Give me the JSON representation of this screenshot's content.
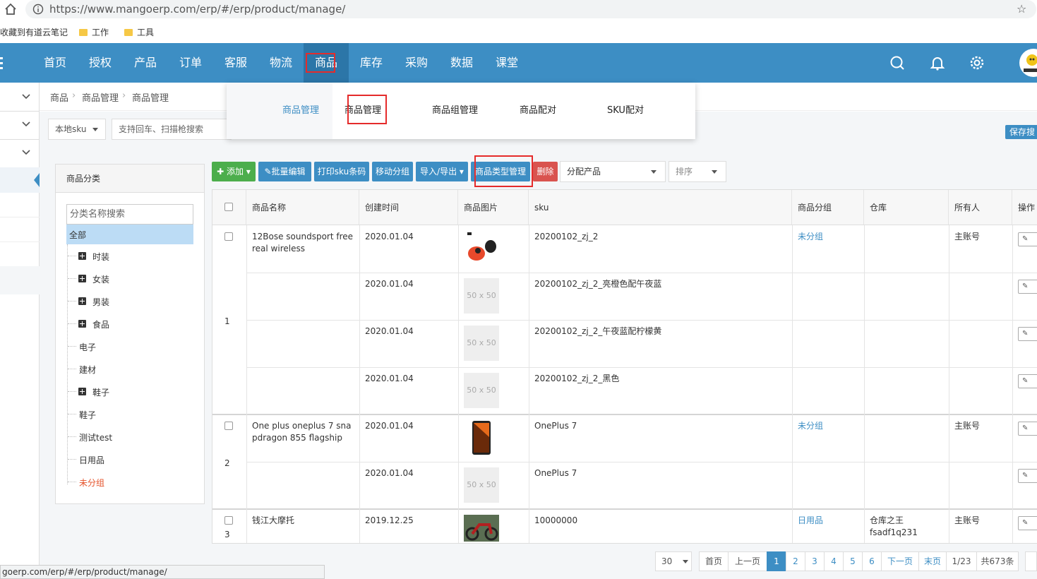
{
  "browser": {
    "url": "https://www.mangoerp.com/erp/#/erp/product/manage/",
    "bookmarks": [
      "收藏到有道云笔记",
      "工作",
      "工具"
    ]
  },
  "nav": {
    "items": [
      "首页",
      "授权",
      "产品",
      "订单",
      "客服",
      "物流",
      "商品",
      "库存",
      "采购",
      "数据",
      "课堂"
    ],
    "active": "商品"
  },
  "breadcrumb": [
    "商品",
    "商品管理",
    "商品管理"
  ],
  "subnav": {
    "title": "商品管理",
    "items": [
      "商品管理",
      "商品组管理",
      "商品配对",
      "SKU配对"
    ]
  },
  "search": {
    "type_select": "本地sku",
    "placeholder": "支持回车、扫描枪搜索",
    "save_button": "保存搜"
  },
  "category": {
    "title": "商品分类",
    "search_placeholder": "分类名称搜索",
    "items": [
      {
        "label": "全部",
        "expandable": false,
        "selected": true
      },
      {
        "label": "时装",
        "expandable": true
      },
      {
        "label": "女装",
        "expandable": true
      },
      {
        "label": "男装",
        "expandable": true
      },
      {
        "label": "食品",
        "expandable": true
      },
      {
        "label": "电子",
        "expandable": false
      },
      {
        "label": "建材",
        "expandable": false
      },
      {
        "label": "鞋子",
        "expandable": true
      },
      {
        "label": "鞋子",
        "expandable": false
      },
      {
        "label": "测试test",
        "expandable": false
      },
      {
        "label": "日用品",
        "expandable": false
      },
      {
        "label": "未分组",
        "expandable": false,
        "highlight": true
      }
    ]
  },
  "toolbar": {
    "add": "添加",
    "batch_edit": "批量编辑",
    "print_sku": "打印sku条码",
    "move_group": "移动分组",
    "import_export": "导入/导出",
    "type_manage": "商品类型管理",
    "delete": "删除",
    "assign_select": "分配产品",
    "sort_select": "排序"
  },
  "table": {
    "headers": [
      "商品名称",
      "创建时间",
      "商品图片",
      "sku",
      "商品分组",
      "仓库",
      "所有人",
      "操作"
    ],
    "rows": [
      {
        "index": "1",
        "name": "12Bose soundsport free real wireless",
        "group": "未分组",
        "warehouse": "",
        "owner": "主账号",
        "variants": [
          {
            "date": "2020.01.04",
            "image": "earbuds",
            "sku": "20200102_zj_2"
          },
          {
            "date": "2020.01.04",
            "image": "50 x 50",
            "sku": "20200102_zj_2_亮橙色配午夜蓝"
          },
          {
            "date": "2020.01.04",
            "image": "50 x 50",
            "sku": "20200102_zj_2_午夜蓝配柠檬黄"
          },
          {
            "date": "2020.01.04",
            "image": "50 x 50",
            "sku": "20200102_zj_2_黑色"
          }
        ]
      },
      {
        "index": "2",
        "name": "One plus oneplus 7 snapdragon 855 flagship",
        "group": "未分组",
        "warehouse": "",
        "owner": "主账号",
        "variants": [
          {
            "date": "2020.01.04",
            "image": "phone",
            "sku": "OnePlus 7"
          },
          {
            "date": "2020.01.04",
            "image": "50 x 50",
            "sku": "OnePlus 7"
          }
        ]
      },
      {
        "index": "3",
        "name": "钱江大摩托",
        "group": "日用品",
        "warehouse": "仓库之王",
        "warehouse2": "fsadf1q231",
        "owner": "主账号",
        "variants": [
          {
            "date": "2019.12.25",
            "image": "motorcycle",
            "sku": "10000000"
          }
        ]
      }
    ]
  },
  "pagination": {
    "page_size": "30",
    "first": "首页",
    "prev": "上一页",
    "pages": [
      "1",
      "2",
      "3",
      "4",
      "5",
      "6"
    ],
    "current": "1",
    "next": "下一页",
    "last": "末页",
    "position": "1/23",
    "total": "共673条"
  },
  "status_url": "goerp.com/erp/#/erp/product/manage/",
  "colors": {
    "brand": "#3d8ec4",
    "add": "#4cae4c",
    "delete": "#d9534f",
    "highlight": "#e52b2b"
  }
}
